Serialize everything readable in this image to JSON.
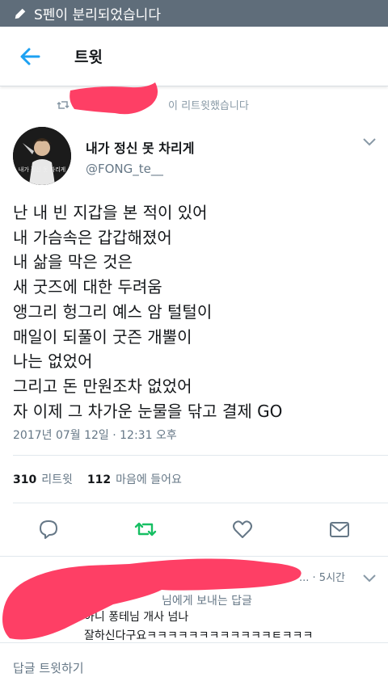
{
  "status_bar": {
    "message": "S펜이 분리되었습니다"
  },
  "header": {
    "title": "트윗"
  },
  "retweet_banner": {
    "text": "이 리트윗했습니다"
  },
  "tweet": {
    "author_name": "내가 정신 못 차리게",
    "handle": "@FONG_te__",
    "avatar_caption": "내가 정신 못 차리게",
    "lines": [
      "난 내 빈 지갑을 본 적이 있어",
      "내 가슴속은 갑갑해졌어",
      "내 삶을 막은 것은",
      "새 굿즈에 대한 두려움",
      "앵그리 헝그리 예스 암 털털이",
      "매일이 되풀이 굿즌 개뿔이",
      "나는 없었어",
      "그리고 돈 만원조차 없었어",
      "자 이제 그 차가운 눈물을 닦고 결제 GO"
    ],
    "timestamp": "2017년 07월 12일 · 12:31 오후",
    "retweets_count": "310",
    "retweets_label": "리트윗",
    "likes_count": "112",
    "likes_label": "마음에 들어요"
  },
  "icons": [
    "pen-icon",
    "back-arrow-icon",
    "retweet-icon",
    "chevron-down-icon",
    "reply-icon",
    "retweet-action-icon",
    "heart-icon",
    "message-icon"
  ],
  "colors": {
    "accent": "#1da1f2",
    "retweet_green": "#17bf63",
    "status_bar": "#5f6d7a",
    "redaction": "#fe3f65"
  },
  "reply": {
    "time": "5시간",
    "partial_line": "님에게 보내는 답글",
    "text_line1": "아니 퐁테님 개사 넘나",
    "text_line2": "잘하신다구요ㅋㅋㅋㅋㅋㅋㅋㅋㅋㅋㅋㅋㅌㅋㅋㅋ"
  },
  "compose": {
    "placeholder": "답글 트윗하기"
  }
}
